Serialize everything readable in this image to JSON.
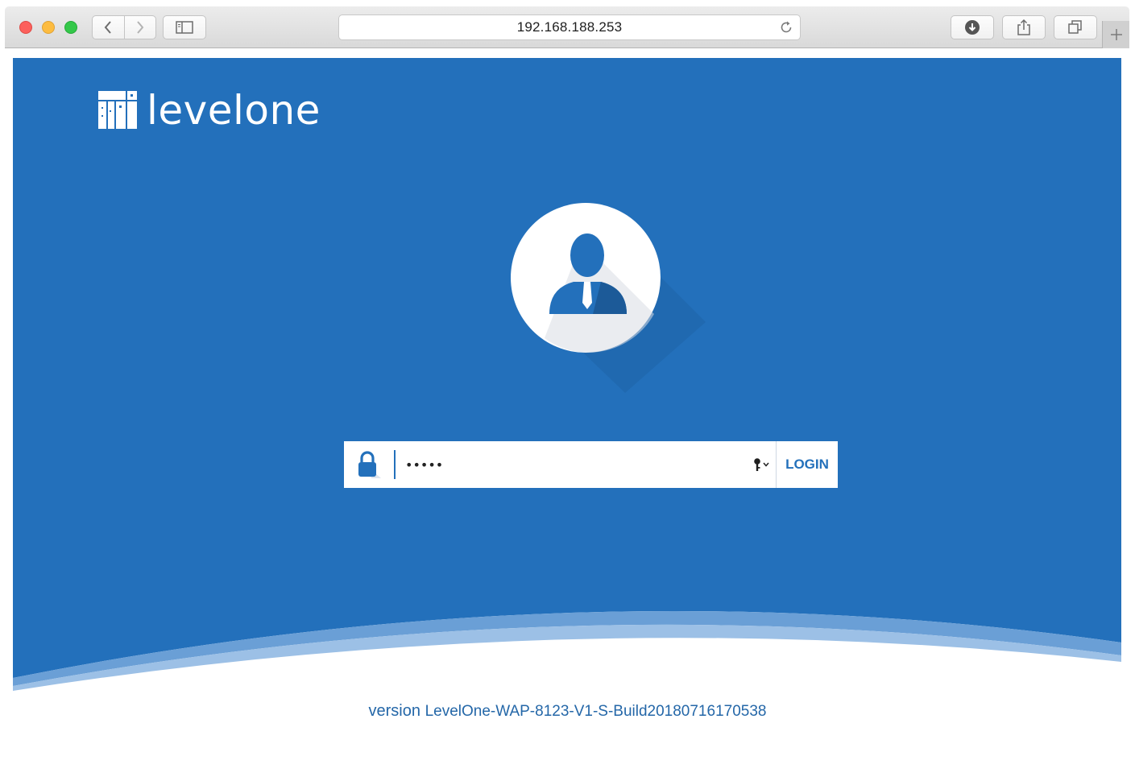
{
  "browser": {
    "url": "192.168.188.253",
    "icons": {
      "back": "chevron-left-icon",
      "forward": "chevron-right-icon",
      "sidebar": "sidebar-icon",
      "reload": "reload-icon",
      "download": "download-icon",
      "share": "share-icon",
      "tabs": "tabs-icon",
      "new_tab": "plus-icon"
    }
  },
  "brand": {
    "name": "levelone",
    "color": "#2370bb"
  },
  "login": {
    "password_value": "admin",
    "button_label": "LOGIN",
    "icons": {
      "lock": "lock-icon",
      "key": "key-icon"
    }
  },
  "footer": {
    "version_prefix": "version",
    "version_build": "LevelOne-WAP-8123-V1-S-Build20180716170538"
  },
  "colors": {
    "background_blue": "#2370bb",
    "wave_light": "#9cc0e6",
    "footer_text": "#2467a8"
  }
}
